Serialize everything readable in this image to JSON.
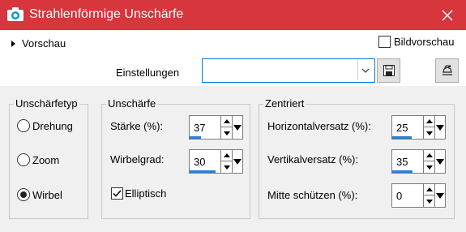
{
  "window": {
    "title": "Strahlenförmige Unschärfe",
    "title_bar_color": "#d6363c",
    "close_icon": "close-icon",
    "app_icon": "camera-icon"
  },
  "top": {
    "preview_label": "Vorschau",
    "preview_expanded": false,
    "bildvorschau_label": "Bildvorschau",
    "bildvorschau_checked": false,
    "settings_label": "Einstellungen",
    "settings_value": "",
    "save_icon": "floppy-disk-icon",
    "reset_icon": "reset-defaults-icon"
  },
  "blur_type": {
    "title": "Unschärfetyp",
    "options": [
      {
        "label": "Drehung",
        "selected": false
      },
      {
        "label": "Zoom",
        "selected": false
      },
      {
        "label": "Wirbel",
        "selected": true
      }
    ]
  },
  "blur": {
    "title": "Unschärfe",
    "strength_label": "Stärke (%):",
    "strength_value": "37",
    "strength_fill_fraction": 0.37,
    "twist_label": "Wirbelgrad:",
    "twist_value": "30",
    "twist_fill_fraction": 0.83,
    "elliptic_label": "Elliptisch",
    "elliptic_checked": true
  },
  "centered": {
    "title": "Zentriert",
    "h_offset_label": "Horizontalversatz (%):",
    "h_offset_value": "25",
    "h_offset_fill_fraction": 0.62,
    "v_offset_label": "Vertikalversatz (%):",
    "v_offset_value": "35",
    "v_offset_fill_fraction": 0.67,
    "protect_center_label": "Mitte schützen (%):",
    "protect_center_value": "0",
    "protect_center_fill_fraction": 0
  },
  "colors": {
    "accent": "#2a7fd6",
    "focus_border": "#0078d7"
  }
}
